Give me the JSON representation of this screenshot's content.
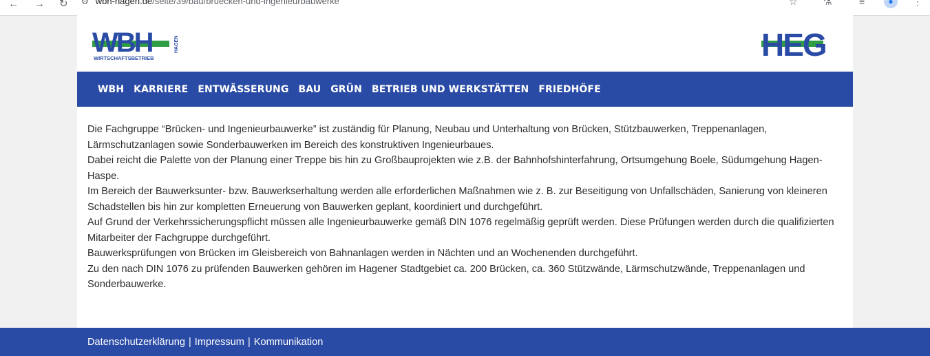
{
  "browser": {
    "url_domain": "wbh-hagen.de",
    "url_path": "/seite/39/bau/bruecken-und-ingenieurbauwerke"
  },
  "header": {
    "logo_left_text": "WBH",
    "logo_left_sub": "WIRTSCHAFTSBETRIEB",
    "logo_left_side": "HAGEN",
    "logo_right_text": "HEG"
  },
  "nav": {
    "items": [
      {
        "label": "WBH"
      },
      {
        "label": "KARRIERE"
      },
      {
        "label": "ENTWÄSSERUNG"
      },
      {
        "label": "BAU"
      },
      {
        "label": "GRÜN"
      },
      {
        "label": "BETRIEB UND WERKSTÄTTEN"
      },
      {
        "label": "FRIEDHÖFE"
      }
    ]
  },
  "content": {
    "paragraphs": [
      "Die Fachgruppe “Brücken- und Ingenieurbauwerke” ist zuständig für Planung, Neubau und Unterhaltung von Brücken, Stützbauwerken, Treppenanlagen, Lärmschutzanlagen  sowie Sonderbauwerken im Bereich des konstruktiven Ingenieurbaues.",
      "Dabei reicht die Palette von der Planung einer Treppe bis hin zu Großbauprojekten wie z.B. der Bahnhofshinterfahrung, Ortsumgehung Boele, Südumgehung Hagen-Haspe.",
      "Im Bereich der Bauwerksunter- bzw. Bauwerkserhaltung werden alle erforderlichen Maßnahmen wie  z. B. zur Beseitigung von Unfallschäden, Sanierung von kleineren Schadstellen bis hin zur kompletten Erneuerung von Bauwerken geplant, koordiniert und durchgeführt.",
      "Auf Grund der Verkehrssicherungspflicht müssen alle Ingenieurbauwerke gemäß DIN 1076 regelmäßig geprüft werden. Diese Prüfungen werden durch die qualifizierten Mitarbeiter der Fachgruppe durchgeführt.",
      "Bauwerksprüfungen von Brücken im Gleisbereich von Bahnanlagen werden in Nächten und an Wochenenden durchgeführt.",
      "Zu den nach DIN 1076 zu prüfenden Bauwerken gehören im Hagener Stadtgebiet ca. 200 Brücken, ca. 360 Stützwände, Lärmschutzwände, Treppenanlagen und Sonderbauwerke."
    ]
  },
  "footer": {
    "links": [
      {
        "label": "Datenschutzerklärung"
      },
      {
        "label": "Impressum"
      },
      {
        "label": "Kommunikation"
      }
    ],
    "separator": "|"
  },
  "colors": {
    "brand_blue": "#2a4ba5",
    "brand_green": "#2f9e44"
  }
}
